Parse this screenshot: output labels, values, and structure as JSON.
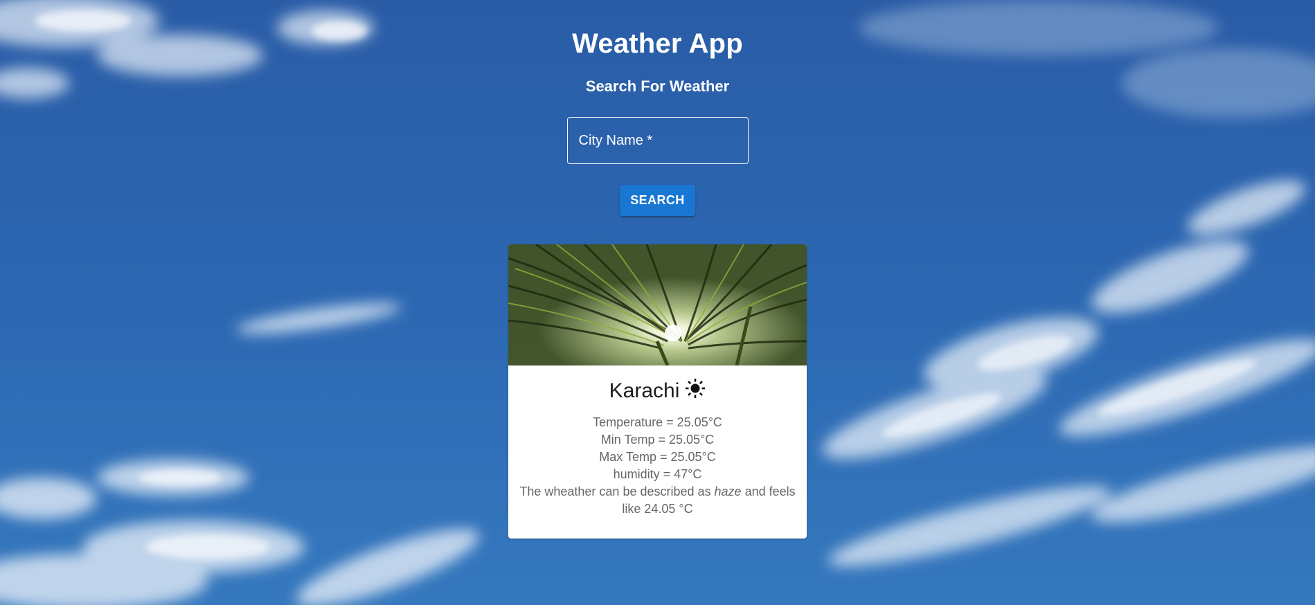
{
  "app": {
    "title": "Weather App",
    "subtitle": "Search For Weather"
  },
  "search": {
    "label": "City Name *",
    "value": "",
    "button_label": "SEARCH"
  },
  "card": {
    "image": "palm-leaves-sun-photo",
    "city": "Karachi",
    "weather_icon": "sun-icon",
    "temperature": "Temperature = 25.05°C",
    "min_temp": "Min Temp = 25.05°C",
    "max_temp": "Max Temp = 25.05°C",
    "humidity": "humidity = 47°C",
    "description_prefix": "The wheather can be described as ",
    "description_condition": "haze",
    "description_suffix": " and feels like 24.05 °C"
  },
  "colors": {
    "button": "#1976d2",
    "card_text_secondary": "#666666",
    "sky_blue": "#2b66b0"
  }
}
